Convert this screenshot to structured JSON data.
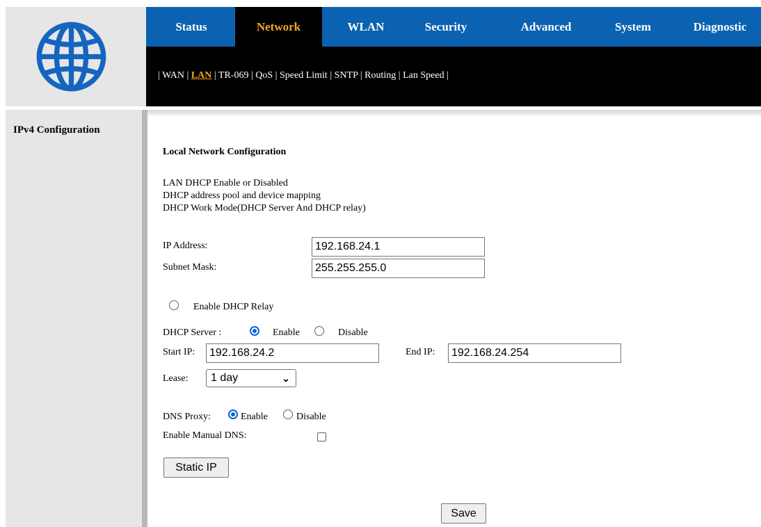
{
  "logo": {
    "icon": "globe-icon",
    "color": "#1565c0"
  },
  "topnav": {
    "tabs": [
      {
        "label": "Status",
        "active": false
      },
      {
        "label": "Network",
        "active": true
      },
      {
        "label": "WLAN",
        "active": false
      },
      {
        "label": "Security",
        "active": false
      },
      {
        "label": "Advanced",
        "active": false
      },
      {
        "label": "System",
        "active": false
      },
      {
        "label": "Diagnostic",
        "active": false
      }
    ],
    "bg_color": "#0a62b0",
    "active_color": "#f5a623"
  },
  "subnav": {
    "links": [
      "WAN",
      "LAN",
      "TR-069",
      "QoS",
      "Speed Limit",
      "SNTP",
      "Routing",
      "Lan Speed"
    ],
    "active": "LAN"
  },
  "sidebar": {
    "items": [
      "IPv4 Configuration"
    ]
  },
  "main": {
    "title": "Local Network Configuration",
    "desc": [
      "LAN DHCP Enable or Disabled",
      "DHCP address pool and device mapping",
      "DHCP Work Mode(DHCP Server And DHCP relay)"
    ],
    "ip_label": "IP Address:",
    "ip_value": "192.168.24.1",
    "mask_label": "Subnet Mask:",
    "mask_value": "255.255.255.0",
    "relay_label": "Enable DHCP Relay",
    "relay_checked": false,
    "dhcp_server_label": "DHCP Server :",
    "dhcp_enable_label": "Enable",
    "dhcp_disable_label": "Disable",
    "dhcp_server_selected": "Enable",
    "start_ip_label": "Start IP:",
    "start_ip_value": "192.168.24.2",
    "end_ip_label": "End IP:",
    "end_ip_value": "192.168.24.254",
    "lease_label": "Lease:",
    "lease_value": "1 day",
    "dns_proxy_label": "DNS Proxy:",
    "dns_enable_label": "Enable",
    "dns_disable_label": "Disable",
    "dns_proxy_selected": "Enable",
    "manual_dns_label": "Enable Manual DNS:",
    "manual_dns_checked": false,
    "static_ip_button": "Static IP",
    "save_button": "Save"
  }
}
